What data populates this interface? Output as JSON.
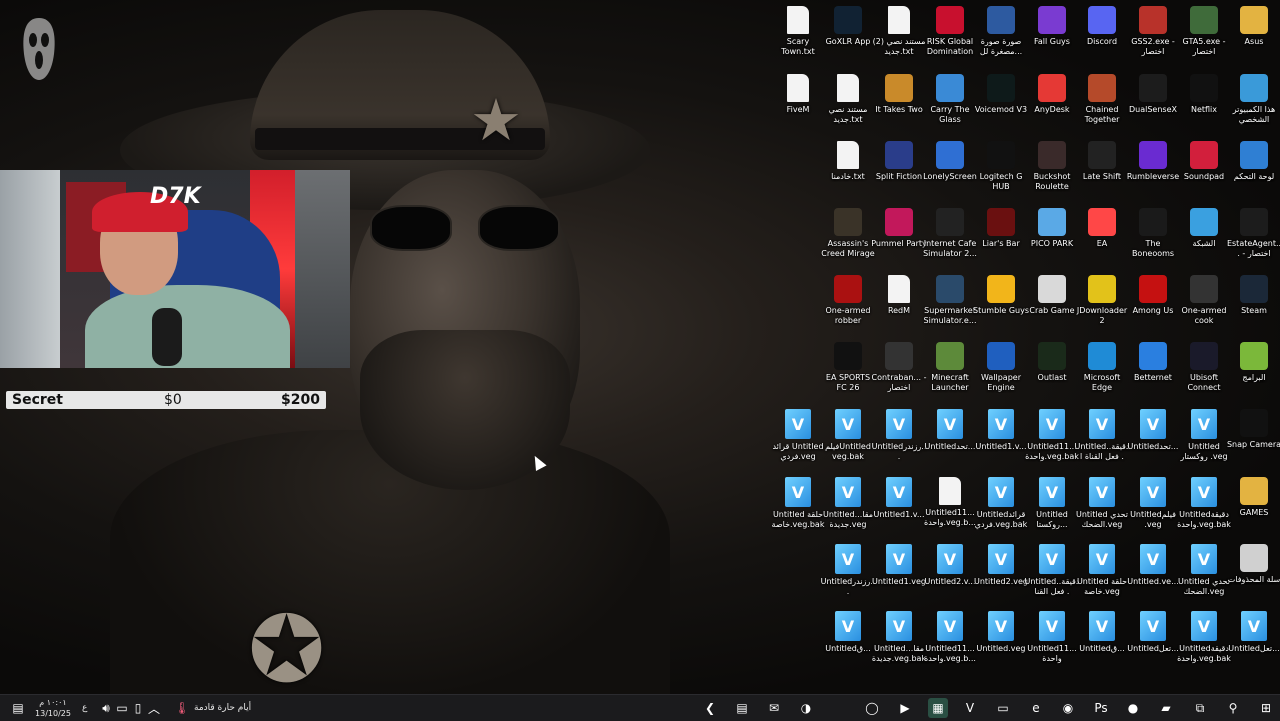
{
  "stream_overlay": {
    "label": "Secret",
    "current": "$0",
    "goal": "$200",
    "cam_logo": "D7K"
  },
  "desktop_icons": [
    {
      "label": "Scary Town.txt",
      "icon": "text-file",
      "color": "#f3f3f3"
    },
    {
      "label": "GoXLR App",
      "icon": "goxlr",
      "color": "#123"
    },
    {
      "label": "مستند نصي (2) جديد.txt",
      "icon": "text-file",
      "color": "#f3f3f3"
    },
    {
      "label": "RISK Global Domination",
      "icon": "risk",
      "color": "#c8102e"
    },
    {
      "label": "صورة صورة مصغرة لل...",
      "icon": "image",
      "color": "#2d5aa0"
    },
    {
      "label": "Fall Guys",
      "icon": "fall-guys",
      "color": "#7a3bd1"
    },
    {
      "label": "Discord",
      "icon": "discord",
      "color": "#5865f2"
    },
    {
      "label": "GSS2.exe - اختصار",
      "icon": "gss2",
      "color": "#b8322a"
    },
    {
      "label": "GTA5.exe - اختصار",
      "icon": "gta5",
      "color": "#3f6b3a"
    },
    {
      "label": "Asus",
      "icon": "folder",
      "color": "#e3b341"
    },
    {
      "label": "FiveM",
      "icon": "text-file",
      "color": "#f3f3f3"
    },
    {
      "label": "مستند نصي جديد.txt",
      "icon": "text-file",
      "color": "#f3f3f3"
    },
    {
      "label": "It Takes Two",
      "icon": "it-takes-two",
      "color": "#c98a2a"
    },
    {
      "label": "Carry The Glass",
      "icon": "carry-glass",
      "color": "#3a8ad6"
    },
    {
      "label": "Voicemod V3",
      "icon": "voicemod",
      "color": "#0e1a1a"
    },
    {
      "label": "AnyDesk",
      "icon": "anydesk",
      "color": "#e53935"
    },
    {
      "label": "Chained Together",
      "icon": "chained",
      "color": "#b54a2a"
    },
    {
      "label": "DualSenseX",
      "icon": "dualsense",
      "color": "#1c1c1c"
    },
    {
      "label": "Netflix",
      "icon": "netflix",
      "color": "#111"
    },
    {
      "label": "هذا الكمبيوتر الشخصي",
      "icon": "this-pc",
      "color": "#3a9ad9"
    },
    {
      "label": "خادمنا.txt",
      "icon": "text-file",
      "color": "#f3f3f3"
    },
    {
      "label": "Split Fiction",
      "icon": "split-fiction",
      "color": "#2a3d8a"
    },
    {
      "label": "LonelyScreen",
      "icon": "lonelyscreen",
      "color": "#2f6fd3"
    },
    {
      "label": "Logitech G HUB",
      "icon": "ghub",
      "color": "#111"
    },
    {
      "label": "Buckshot Roulette",
      "icon": "buckshot",
      "color": "#3a2a2a"
    },
    {
      "label": "Late Shift",
      "icon": "late-shift",
      "color": "#222"
    },
    {
      "label": "Rumbleverse",
      "icon": "rumbleverse",
      "color": "#6a2bd1"
    },
    {
      "label": "Soundpad",
      "icon": "soundpad",
      "color": "#d21f3c"
    },
    {
      "label": "لوحة التحكم",
      "icon": "control-panel",
      "color": "#2f7fd3"
    },
    {
      "label": "Assassin's Creed Mirage",
      "icon": "ac-mirage",
      "color": "#3a3328"
    },
    {
      "label": "Pummel Party",
      "icon": "pummel",
      "color": "#c2185b"
    },
    {
      "label": "Internet Cafe Simulator 2...",
      "icon": "ics2",
      "color": "#222"
    },
    {
      "label": "Liar's Bar",
      "icon": "liars-bar",
      "color": "#6a1010"
    },
    {
      "label": "PICO PARK",
      "icon": "pico-park",
      "color": "#5aa9e6"
    },
    {
      "label": "EA",
      "icon": "ea",
      "color": "#ff4747"
    },
    {
      "label": "The Boneooms",
      "icon": "boneooms",
      "color": "#1a1a1a"
    },
    {
      "label": "الشبكة",
      "icon": "network",
      "color": "#3aa0e0"
    },
    {
      "label": "EstateAgent... - اختصار",
      "icon": "estate-agent",
      "color": "#1c1c1c"
    },
    {
      "label": "One-armed robber",
      "icon": "oar",
      "color": "#a11"
    },
    {
      "label": "RedM",
      "icon": "text-file",
      "color": "#f3f3f3"
    },
    {
      "label": "Supermarket Simulator.e...",
      "icon": "supermarket",
      "color": "#2a4a6a"
    },
    {
      "label": "Stumble Guys",
      "icon": "stumble",
      "color": "#f2b51a"
    },
    {
      "label": "Crab Game",
      "icon": "crab",
      "color": "#d9d9d9"
    },
    {
      "label": "JDownloader 2",
      "icon": "jdownloader",
      "color": "#e2c21a"
    },
    {
      "label": "Among Us",
      "icon": "among-us",
      "color": "#c51111"
    },
    {
      "label": "One-armed cook",
      "icon": "oac",
      "color": "#333"
    },
    {
      "label": "Steam",
      "icon": "steam",
      "color": "#1b2838"
    },
    {
      "label": "EA SPORTS FC 26",
      "icon": "fc26",
      "color": "#111"
    },
    {
      "label": "Contraban... - اختصار",
      "icon": "contraband",
      "color": "#333"
    },
    {
      "label": "Minecraft Launcher",
      "icon": "minecraft",
      "color": "#5d8a3a"
    },
    {
      "label": "Wallpaper Engine",
      "icon": "wallpaper-engine",
      "color": "#1f5fbf"
    },
    {
      "label": "Outlast",
      "icon": "outlast",
      "color": "#1a2a1a"
    },
    {
      "label": "Microsoft Edge",
      "icon": "edge",
      "color": "#1f8bd6"
    },
    {
      "label": "Betternet",
      "icon": "betternet",
      "color": "#2a7fe0"
    },
    {
      "label": "Ubisoft Connect",
      "icon": "ubisoft",
      "color": "#1a1a2a"
    },
    {
      "label": "البرامج",
      "icon": "folder",
      "color": "#7bb83a"
    },
    {
      "label": "قرائد Untitled فردي.veg",
      "icon": "vegas",
      "color": "#3fa9f5"
    },
    {
      "label": "فيلمUntitled veg.bak",
      "icon": "vegas",
      "color": "#3fa9f5"
    },
    {
      "label": "Untitledرزندر...",
      "icon": "vegas",
      "color": "#3fa9f5"
    },
    {
      "label": "Untitledتحد...",
      "icon": "vegas",
      "color": "#3fa9f5"
    },
    {
      "label": "Untitled1.v...",
      "icon": "vegas",
      "color": "#3fa9f5"
    },
    {
      "label": "Untitled11... واحدة.veg.bak",
      "icon": "vegas",
      "color": "#3fa9f5"
    },
    {
      "label": "Untitledدقيقة... فعل القناة ا",
      "icon": "vegas",
      "color": "#3fa9f5"
    },
    {
      "label": "Untitledتحد...",
      "icon": "vegas",
      "color": "#3fa9f5"
    },
    {
      "label": "Untitled روكستار .veg",
      "icon": "vegas",
      "color": "#3fa9f5"
    },
    {
      "label": "Snap Camera",
      "icon": "snap-camera",
      "color": "#111"
    },
    {
      "label": "Untitled حلقة خاصة.veg.bak",
      "icon": "vegas",
      "color": "#3fa9f5"
    },
    {
      "label": "Untitledمقا... جديدة.veg",
      "icon": "vegas",
      "color": "#3fa9f5"
    },
    {
      "label": "Untitled1.v...",
      "icon": "vegas",
      "color": "#3fa9f5"
    },
    {
      "label": "Untitled11... واحدة.veg.b...",
      "icon": "text-file",
      "color": "#f3f3f3"
    },
    {
      "label": "Untitledقرائد فردي.veg.bak",
      "icon": "vegas",
      "color": "#3fa9f5"
    },
    {
      "label": "Untitled روكستا...",
      "icon": "vegas",
      "color": "#3fa9f5"
    },
    {
      "label": "Untitled تحدي الضحك.veg",
      "icon": "vegas",
      "color": "#3fa9f5"
    },
    {
      "label": "Untitledفيلم .veg",
      "icon": "vegas",
      "color": "#3fa9f5"
    },
    {
      "label": "Untitledدقيقة واحدة.veg.bak",
      "icon": "vegas",
      "color": "#3fa9f5"
    },
    {
      "label": "GAMES",
      "icon": "folder",
      "color": "#e3b341"
    },
    {
      "label": "Untitledرزندر...",
      "icon": "vegas",
      "color": "#3fa9f5"
    },
    {
      "label": "Untitled1.veg",
      "icon": "vegas",
      "color": "#3fa9f5"
    },
    {
      "label": "Untitled2.v...",
      "icon": "vegas",
      "color": "#3fa9f5"
    },
    {
      "label": "Untitled2.veg",
      "icon": "vegas",
      "color": "#3fa9f5"
    },
    {
      "label": "Untitledدقيقة... فعل القنا",
      "icon": "vegas",
      "color": "#3fa9f5"
    },
    {
      "label": "Untitled حلقة خاصة.veg",
      "icon": "vegas",
      "color": "#3fa9f5"
    },
    {
      "label": "Untitled.ve...",
      "icon": "vegas",
      "color": "#3fa9f5"
    },
    {
      "label": "Untitled تحدي الضحك.veg",
      "icon": "vegas",
      "color": "#3fa9f5"
    },
    {
      "label": "سلة المحذوفات",
      "icon": "recycle-bin",
      "color": "#d0d0d0"
    },
    {
      "label": "Untitledق...",
      "icon": "vegas",
      "color": "#3fa9f5"
    },
    {
      "label": "Untitledمقا... جديدة.veg.bak",
      "icon": "vegas",
      "color": "#3fa9f5"
    },
    {
      "label": "Untitled11... واحدة.veg.b...",
      "icon": "vegas",
      "color": "#3fa9f5"
    },
    {
      "label": "Untitled.veg",
      "icon": "vegas",
      "color": "#3fa9f5"
    },
    {
      "label": "Untitled11... واحدة",
      "icon": "vegas",
      "color": "#3fa9f5"
    },
    {
      "label": "Untitledق...",
      "icon": "vegas",
      "color": "#3fa9f5"
    },
    {
      "label": "Untitledتعل...",
      "icon": "vegas",
      "color": "#3fa9f5"
    },
    {
      "label": "Untitledدقيقة واحدة.veg.bak",
      "icon": "vegas",
      "color": "#3fa9f5"
    },
    {
      "label": "Untitledتعل...",
      "icon": "vegas",
      "color": "#3fa9f5"
    }
  ],
  "taskbar": {
    "clock_time": "١٠:٠١ م",
    "clock_date": "13/10/25",
    "lang": "ع",
    "weather": "أيام حارة قادمة",
    "apps": [
      {
        "name": "back-arrow-icon",
        "glyph": "❮"
      },
      {
        "name": "notepad-icon",
        "glyph": "▤"
      },
      {
        "name": "outlook-icon",
        "glyph": "✉"
      },
      {
        "name": "copilot-icon",
        "glyph": "◑"
      },
      {
        "name": "cortana-icon",
        "glyph": "◯"
      },
      {
        "name": "video-icon",
        "glyph": "▶"
      },
      {
        "name": "store-icon",
        "glyph": "▦"
      },
      {
        "name": "vegas-icon",
        "glyph": "V"
      },
      {
        "name": "file-explorer-icon",
        "glyph": "▭"
      },
      {
        "name": "edge-icon",
        "glyph": "e"
      },
      {
        "name": "chrome-canary-icon",
        "glyph": "◉"
      },
      {
        "name": "photoshop-icon",
        "glyph": "Ps"
      },
      {
        "name": "chrome-icon",
        "glyph": "●"
      },
      {
        "name": "files-icon",
        "glyph": "▰"
      },
      {
        "name": "task-view-icon",
        "glyph": "⧉"
      },
      {
        "name": "search-icon",
        "glyph": "⚲"
      },
      {
        "name": "start-icon",
        "glyph": "⊞"
      }
    ]
  },
  "colors": {
    "taskbar_bg": "#1b1b1d",
    "statbar_bg": "#e7e7e7"
  }
}
